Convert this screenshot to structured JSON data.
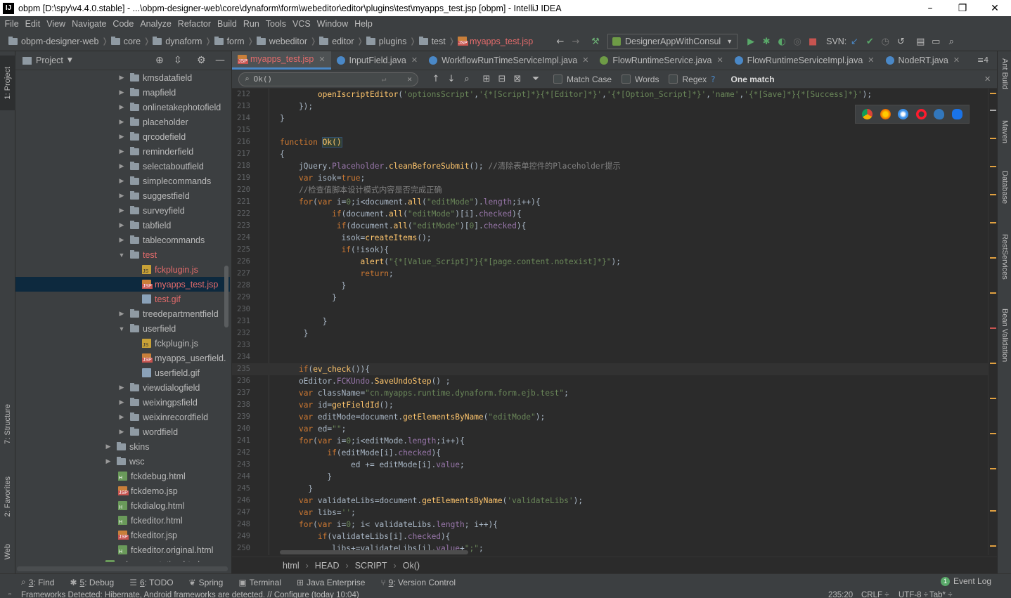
{
  "window": {
    "title": "obpm [D:\\spy\\v4.4.0.stable] - ...\\obpm-designer-web\\core\\dynaform\\form\\webeditor\\editor\\plugins\\test\\myapps_test.jsp [obpm] - IntelliJ IDEA",
    "app_icon": "IJ",
    "minimize": "–",
    "maximize": "❐",
    "close": "✕"
  },
  "menu": [
    "File",
    "Edit",
    "View",
    "Navigate",
    "Code",
    "Analyze",
    "Refactor",
    "Build",
    "Run",
    "Tools",
    "VCS",
    "Window",
    "Help"
  ],
  "breadcrumbs": [
    "obpm-designer-web",
    "core",
    "dynaform",
    "form",
    "webeditor",
    "editor",
    "plugins",
    "test",
    "myapps_test.jsp"
  ],
  "toolbar": {
    "run_config": "DesignerAppWithConsul",
    "svn_label": "SVN:"
  },
  "left_tool_tabs": [
    "1: Project",
    "7: Structure",
    "2: Favorites",
    "Web"
  ],
  "right_tool_tabs": [
    "Ant Build",
    "Maven",
    "Database",
    "RestServices",
    "Bean Validation"
  ],
  "project_panel": {
    "title": "Project",
    "tree": [
      {
        "label": "kmsdatafield",
        "type": "folder",
        "depth": 1,
        "expanded": false
      },
      {
        "label": "mapfield",
        "type": "folder",
        "depth": 1,
        "expanded": false
      },
      {
        "label": "onlinetakephotofield",
        "type": "folder",
        "depth": 1,
        "expanded": false
      },
      {
        "label": "placeholder",
        "type": "folder",
        "depth": 1,
        "expanded": false
      },
      {
        "label": "qrcodefield",
        "type": "folder",
        "depth": 1,
        "expanded": false
      },
      {
        "label": "reminderfield",
        "type": "folder",
        "depth": 1,
        "expanded": false
      },
      {
        "label": "selectaboutfield",
        "type": "folder",
        "depth": 1,
        "expanded": false
      },
      {
        "label": "simplecommands",
        "type": "folder",
        "depth": 1,
        "expanded": false
      },
      {
        "label": "suggestfield",
        "type": "folder",
        "depth": 1,
        "expanded": false
      },
      {
        "label": "surveyfield",
        "type": "folder",
        "depth": 1,
        "expanded": false
      },
      {
        "label": "tabfield",
        "type": "folder",
        "depth": 1,
        "expanded": false
      },
      {
        "label": "tablecommands",
        "type": "folder",
        "depth": 1,
        "expanded": false
      },
      {
        "label": "test",
        "type": "folder",
        "depth": 1,
        "expanded": true,
        "red": true
      },
      {
        "label": "fckplugin.js",
        "type": "js",
        "depth": 2,
        "red": true
      },
      {
        "label": "myapps_test.jsp",
        "type": "jsp",
        "depth": 2,
        "red": true,
        "selected": true
      },
      {
        "label": "test.gif",
        "type": "gif",
        "depth": 2,
        "red": true
      },
      {
        "label": "treedepartmentfield",
        "type": "folder",
        "depth": 1,
        "expanded": false
      },
      {
        "label": "userfield",
        "type": "folder",
        "depth": 1,
        "expanded": true
      },
      {
        "label": "fckplugin.js",
        "type": "js",
        "depth": 2
      },
      {
        "label": "myapps_userfield.",
        "type": "jsp",
        "depth": 2
      },
      {
        "label": "userfield.gif",
        "type": "gif",
        "depth": 2
      },
      {
        "label": "viewdialogfield",
        "type": "folder",
        "depth": 1,
        "expanded": false
      },
      {
        "label": "weixingpsfield",
        "type": "folder",
        "depth": 1,
        "expanded": false
      },
      {
        "label": "weixinrecordfield",
        "type": "folder",
        "depth": 1,
        "expanded": false
      },
      {
        "label": "wordfield",
        "type": "folder",
        "depth": 1,
        "expanded": false
      },
      {
        "label": "skins",
        "type": "folder",
        "depth": 0,
        "expanded": false
      },
      {
        "label": "wsc",
        "type": "folder",
        "depth": 0,
        "expanded": false
      },
      {
        "label": "fckdebug.html",
        "type": "html",
        "depth": 0
      },
      {
        "label": "fckdemo.jsp",
        "type": "jsp",
        "depth": 0
      },
      {
        "label": "fckdialog.html",
        "type": "html",
        "depth": 0
      },
      {
        "label": "fckeditor.html",
        "type": "html",
        "depth": 0
      },
      {
        "label": "fckeditor.jsp",
        "type": "jsp",
        "depth": 0
      },
      {
        "label": "fckeditor.original.html",
        "type": "html",
        "depth": 0
      },
      {
        "label": "_documentation.html",
        "type": "html",
        "depth": -1
      }
    ]
  },
  "editor_tabs": [
    {
      "label": "myapps_test.jsp",
      "kind": "jsp",
      "active": true
    },
    {
      "label": "InputField.java",
      "kind": "class"
    },
    {
      "label": "WorkflowRunTimeServiceImpl.java",
      "kind": "class"
    },
    {
      "label": "FlowRuntimeService.java",
      "kind": "interface"
    },
    {
      "label": "FlowRuntimeServiceImpl.java",
      "kind": "class"
    },
    {
      "label": "NodeRT.java",
      "kind": "class"
    }
  ],
  "tabs_overflow": "≡4",
  "find": {
    "query": "Ok()",
    "match_case": "Match Case",
    "words": "Words",
    "regex": "Regex",
    "help": "?",
    "result": "One match"
  },
  "code_lines": [
    {
      "n": "212",
      "h": "        <span class='fn'>openIscriptEditor</span>(<span class='str'>'optionsScript'</span>,<span class='str'>'{*[Script]*}{*[Editor]*}'</span>,<span class='str'>'{*[Option_Script]*}'</span>,<span class='str'>'name'</span>,<span class='str'>'{*[Save]*}{*[Success]*}'</span>);"
    },
    {
      "n": "213",
      "h": "    });"
    },
    {
      "n": "214",
      "h": "}"
    },
    {
      "n": "215",
      "h": ""
    },
    {
      "n": "216",
      "h": "<span class='kw'>function</span> <span class='fn hl'>Ok()</span>"
    },
    {
      "n": "217",
      "h": "{"
    },
    {
      "n": "218",
      "h": "    jQuery.<span class='pr'>Placeholder</span>.<span class='fn'>cleanBeforeSubmit</span>(); <span class='cmt'>//清除表单控件的Placeholder提示</span>"
    },
    {
      "n": "219",
      "h": "    <span class='kw'>var</span> isok=<span class='kw'>true</span>;"
    },
    {
      "n": "220",
      "h": "    <span class='cmt'>//检查值脚本设计模式内容是否完成正确</span>"
    },
    {
      "n": "221",
      "h": "    <span class='kw'>for</span>(<span class='kw'>var</span> i=<span class='str'>0</span>;i&lt;document.<span class='fn'>all</span>(<span class='str'>\"editMode\"</span>).<span class='pr'>length</span>;i++){"
    },
    {
      "n": "222",
      "h": "           <span class='kw'>if</span>(document.<span class='fn'>all</span>(<span class='str'>\"editMode\"</span>)[i].<span class='pr'>checked</span>){"
    },
    {
      "n": "223",
      "h": "            <span class='kw'>if</span>(document.<span class='fn'>all</span>(<span class='str'>\"editMode\"</span>)[<span class='str'>0</span>].<span class='pr'>checked</span>){"
    },
    {
      "n": "224",
      "h": "             isok=<span class='fn'>createItems</span>();"
    },
    {
      "n": "225",
      "h": "             <span class='kw'>if</span>(!isok){"
    },
    {
      "n": "226",
      "h": "                 <span class='fn'>alert</span>(<span class='str'>\"{*[Value_Script]*}{*[page.content.notexist]*}\"</span>);"
    },
    {
      "n": "227",
      "h": "                 <span class='kw'>return</span>;"
    },
    {
      "n": "228",
      "h": "             }"
    },
    {
      "n": "229",
      "h": "           }"
    },
    {
      "n": "230",
      "h": ""
    },
    {
      "n": "231",
      "h": "         }"
    },
    {
      "n": "232",
      "h": "     }"
    },
    {
      "n": "233",
      "h": ""
    },
    {
      "n": "234",
      "h": ""
    },
    {
      "n": "235",
      "h": "    <span class='kw'>if</span>(<span class='fn'>ev_check</span>()){",
      "cur": true
    },
    {
      "n": "236",
      "h": "    oEditor.<span class='pr'>FCKUndo</span>.<span class='fn'>SaveUndoStep</span>() ;"
    },
    {
      "n": "237",
      "h": "    <span class='kw'>var</span> className=<span class='str'>\"cn.myapps.runtime.dynaform.form.ejb.test\"</span>;"
    },
    {
      "n": "238",
      "h": "    <span class='kw'>var</span> id=<span class='fn'>getFieldId</span>();"
    },
    {
      "n": "239",
      "h": "    <span class='kw'>var</span> editMode=document.<span class='fn'>getElementsByName</span>(<span class='str'>\"editMode\"</span>);"
    },
    {
      "n": "240",
      "h": "    <span class='kw'>var</span> ed=<span class='str'>\"\"</span>;"
    },
    {
      "n": "241",
      "h": "    <span class='kw'>for</span>(<span class='kw'>var</span> i=<span class='str'>0</span>;i&lt;editMode.<span class='pr'>length</span>;i++){"
    },
    {
      "n": "242",
      "h": "          <span class='kw'>if</span>(editMode[i].<span class='pr'>checked</span>){"
    },
    {
      "n": "243",
      "h": "               ed += editMode[i].<span class='pr'>value</span>;"
    },
    {
      "n": "244",
      "h": "          }"
    },
    {
      "n": "245",
      "h": "      }"
    },
    {
      "n": "246",
      "h": "    <span class='kw'>var</span> validateLibs=document.<span class='fn'>getElementsByName</span>(<span class='str'>'validateLibs'</span>);"
    },
    {
      "n": "247",
      "h": "    <span class='kw'>var</span> libs=<span class='str'>''</span>;"
    },
    {
      "n": "248",
      "h": "    <span class='kw'>for</span>(<span class='kw'>var</span> i=<span class='str'>0</span>; i&lt; validateLibs.<span class='pr'>length</span>; i++){"
    },
    {
      "n": "249",
      "h": "        <span class='kw'>if</span>(validateLibs[i].<span class='pr'>checked</span>){"
    },
    {
      "n": "250",
      "h": "           libs+=validateLibs[i].<span class='pr'>value</span>+<span class='str'>\";\"</span>;"
    }
  ],
  "editor_breadcrumb": [
    "html",
    "HEAD",
    "SCRIPT",
    "Ok()"
  ],
  "bottom_tools": [
    {
      "key": "3",
      "label": ": Find",
      "icon": "search-icon"
    },
    {
      "key": "5",
      "label": ": Debug",
      "icon": "bug-icon"
    },
    {
      "key": "6",
      "label": ": TODO",
      "icon": "list-icon"
    },
    {
      "key": "",
      "label": "Spring",
      "icon": "leaf-icon"
    },
    {
      "key": "",
      "label": "Terminal",
      "icon": "terminal-icon"
    },
    {
      "key": "",
      "label": "Java Enterprise",
      "icon": "enterprise-icon"
    },
    {
      "key": "9",
      "label": ": Version Control",
      "icon": "vcs-icon"
    }
  ],
  "event_log": {
    "badge": "1",
    "label": "Event Log"
  },
  "status": {
    "message": "Frameworks Detected: Hibernate, Android frameworks are detected. // Configure (today 10:04)",
    "position": "235:20",
    "line_sep": "CRLF ÷",
    "encoding": "UTF-8 ÷",
    "indent": "Tab* ÷"
  },
  "colors": {
    "accent": "#4a88c7",
    "bg": "#2b2b2b",
    "panel": "#3c3f41",
    "red_file": "#e36b6b",
    "selection": "#0d293e"
  }
}
